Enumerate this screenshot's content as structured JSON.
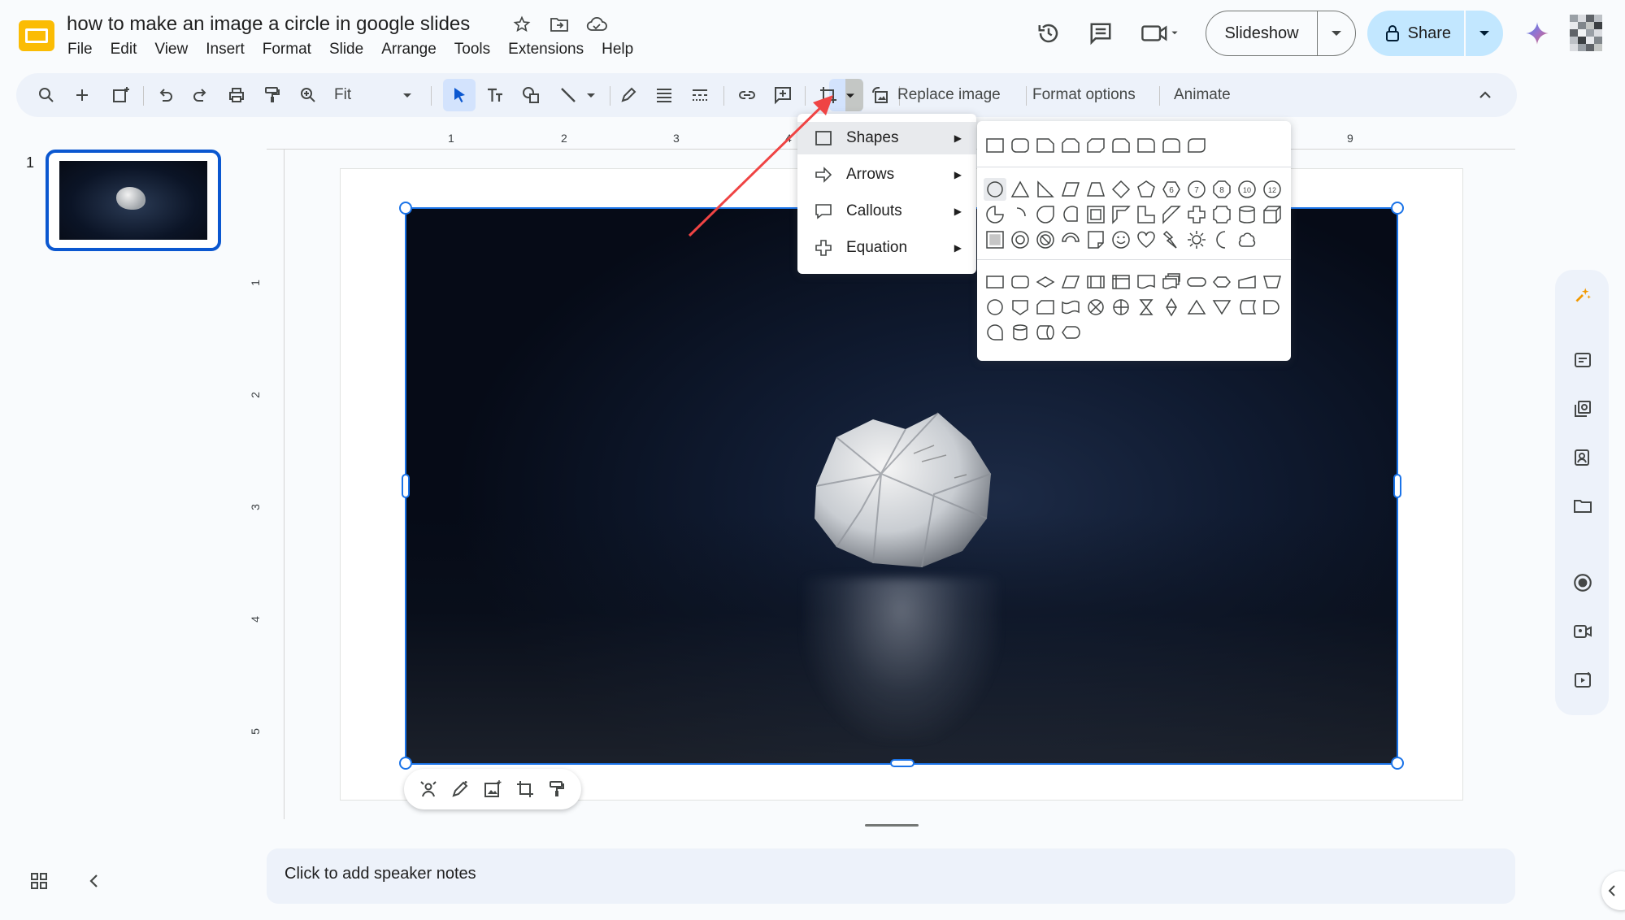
{
  "header": {
    "title": "how to make an image a circle in google slides",
    "menu": [
      "File",
      "Edit",
      "View",
      "Insert",
      "Format",
      "Slide",
      "Arrange",
      "Tools",
      "Extensions",
      "Help"
    ],
    "slideshow_label": "Slideshow",
    "share_label": "Share"
  },
  "toolbar": {
    "zoom_value": "Fit",
    "replace_image_label": "Replace image",
    "format_options_label": "Format options",
    "animate_label": "Animate"
  },
  "filmstrip": {
    "slide_number": "1"
  },
  "rulers": {
    "top": [
      "1",
      "2",
      "3",
      "4",
      "9"
    ],
    "left": [
      "1",
      "2",
      "3",
      "4",
      "5"
    ]
  },
  "crop_menu": {
    "items": [
      {
        "label": "Shapes",
        "icon": "square-icon"
      },
      {
        "label": "Arrows",
        "icon": "arrow-right-icon"
      },
      {
        "label": "Callouts",
        "icon": "callout-icon"
      },
      {
        "label": "Equation",
        "icon": "plus-icon"
      }
    ]
  },
  "shapes_panel": {
    "numbered_shapes": [
      "6",
      "7",
      "8",
      "10",
      "12"
    ]
  },
  "notes": {
    "placeholder": "Click to add speaker notes"
  },
  "colors": {
    "accent": "#1a73e8",
    "share_bg": "#c2e7ff",
    "toolbar_bg": "#edf2fa",
    "annotation_arrow": "#ef4444"
  }
}
